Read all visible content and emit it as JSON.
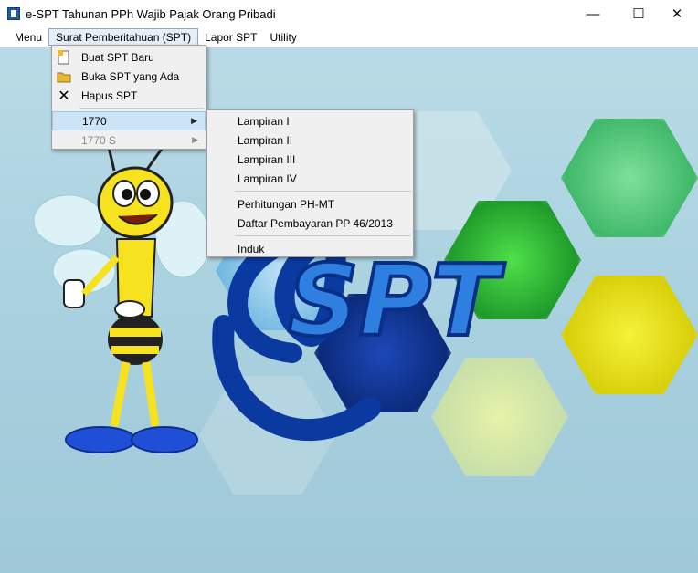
{
  "window": {
    "title": "e-SPT Tahunan PPh Wajib Pajak Orang Pribadi",
    "minimize_glyph": "—",
    "maximize_glyph": "☐",
    "close_glyph": "✕"
  },
  "menubar": {
    "items": [
      {
        "label": "Menu"
      },
      {
        "label": "Surat Pemberitahuan (SPT)"
      },
      {
        "label": "Lapor SPT"
      },
      {
        "label": "Utility"
      }
    ]
  },
  "spt_menu": {
    "items": [
      {
        "label": "Buat SPT Baru",
        "icon": "new-document-icon"
      },
      {
        "label": "Buka SPT yang Ada",
        "icon": "open-folder-icon"
      },
      {
        "label": "Hapus SPT",
        "icon": "delete-icon"
      }
    ],
    "submenus": [
      {
        "label": "1770",
        "state": "highlighted"
      },
      {
        "label": "1770 S",
        "state": "disabled"
      }
    ]
  },
  "submenu_1770": {
    "group1": [
      "Lampiran I",
      "Lampiran II",
      "Lampiran III",
      "Lampiran IV"
    ],
    "group2": [
      "Perhitungan PH-MT",
      "Daftar Pembayaran PP 46/2013"
    ],
    "group3": [
      "Induk"
    ]
  },
  "logo": {
    "text": "SPT"
  },
  "colors": {
    "menu_highlight": "#cde4f7",
    "background": "#a8d0df"
  }
}
